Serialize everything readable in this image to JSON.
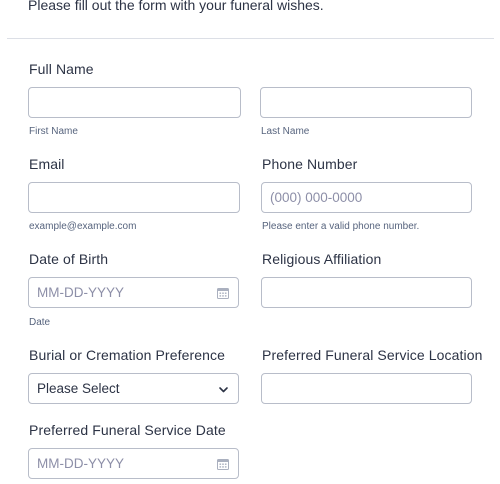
{
  "intro_text": "Please fill out the form with your funeral wishes.",
  "full_name": {
    "label": "Full Name",
    "first_sublabel": "First Name",
    "last_sublabel": "Last Name"
  },
  "email": {
    "label": "Email",
    "sublabel": "example@example.com"
  },
  "phone": {
    "label": "Phone Number",
    "placeholder": "(000) 000-0000",
    "sublabel": "Please enter a valid phone number."
  },
  "dob": {
    "label": "Date of Birth",
    "placeholder": "MM-DD-YYYY",
    "sublabel": "Date",
    "icon": "calendar-icon"
  },
  "religion": {
    "label": "Religious Affiliation"
  },
  "burial": {
    "label": "Burial or Cremation Preference",
    "selected": "Please Select",
    "icon": "chevron-down-icon"
  },
  "location": {
    "label": "Preferred Funeral Service Location"
  },
  "service_date": {
    "label": "Preferred Funeral Service Date",
    "placeholder": "MM-DD-YYYY",
    "icon": "calendar-icon"
  },
  "colors": {
    "text": "#2c3345",
    "placeholder": "#8d8fa8",
    "border": "#b8bdc9",
    "sublabel": "#57647e"
  }
}
